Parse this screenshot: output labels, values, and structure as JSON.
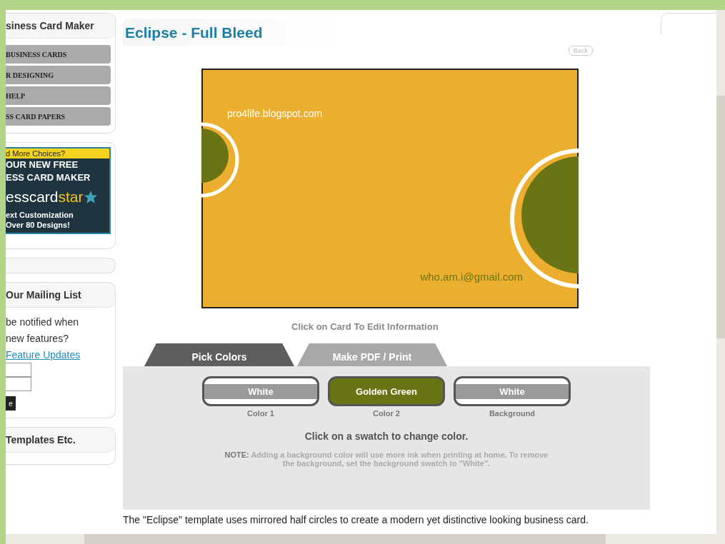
{
  "sidebar": {
    "title": "siness Card Maker",
    "menu": [
      "BUSINESS CARDS",
      "R DESIGNING",
      "HELP",
      "SS CARD PAPERS"
    ],
    "ad": {
      "top": "d More Choices?",
      "line_1": "OUR NEW FREE",
      "line_2": "ESS CARD MAKER",
      "brand": "esscard",
      "brand_accent": "star",
      "line_3": "ext Customization",
      "line_4": "Over 80 Designs!"
    },
    "mailing": {
      "title": "Our Mailing List",
      "text": "be notified when new features?",
      "link": "Feature Updates",
      "button": "e"
    },
    "templates": {
      "title": "Templates Etc."
    }
  },
  "main": {
    "title": "Eclipse - Full Bleed",
    "back": "Back",
    "card": {
      "website": "pro4life.blogspot.com",
      "email": "who.am.i@gmail.com"
    },
    "caption": "Click on Card To Edit Information",
    "tabs": [
      {
        "label": "Pick Colors",
        "selected": true
      },
      {
        "label": "Make PDF / Print",
        "selected": false
      }
    ],
    "swatches": [
      {
        "name": "White",
        "label": "Color 1",
        "color": "#ffffff"
      },
      {
        "name": "Golden Green",
        "label": "Color 2",
        "color": "#6b7415"
      },
      {
        "name": "White",
        "label": "Background",
        "color": "#ffffff"
      }
    ],
    "instruction": "Click on a swatch to change color.",
    "note": "**NOTE:** Adding a background color will use more ink when printing at home. To remove the background, set the background swatch to \"White\".",
    "description": "The \"Eclipse\" template uses mirrored half circles to create a modern yet distinctive looking business card."
  }
}
